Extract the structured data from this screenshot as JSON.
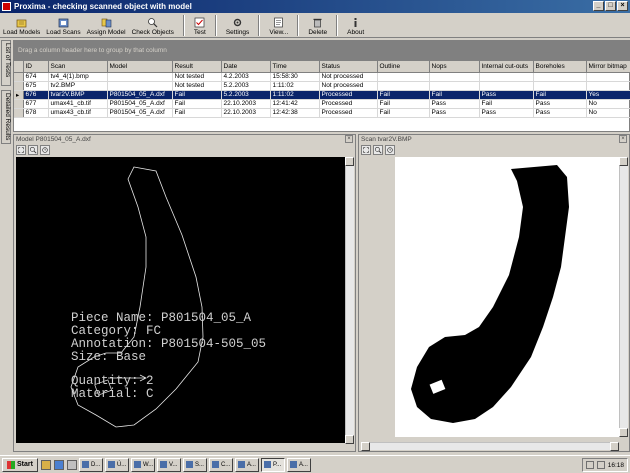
{
  "window": {
    "title": "Proxima - checking scanned object with model"
  },
  "toolbar": {
    "buttons": [
      {
        "label": "Load Models",
        "icon": "load-models-icon"
      },
      {
        "label": "Load Scans",
        "icon": "load-scans-icon"
      },
      {
        "label": "Assign Model",
        "icon": "assign-model-icon"
      },
      {
        "label": "Check Objects",
        "icon": "check-objects-icon"
      },
      {
        "label": "Test",
        "icon": "test-icon"
      },
      {
        "label": "Settings",
        "icon": "settings-icon"
      },
      {
        "label": "View...",
        "icon": "view-icon"
      },
      {
        "label": "Delete",
        "icon": "delete-icon"
      },
      {
        "label": "About",
        "icon": "about-icon"
      }
    ]
  },
  "side_tabs": {
    "list_of_tests": "List of Tests",
    "detailed_results": "Detailed Results"
  },
  "grid": {
    "group_hint": "Drag a column header here to group by that column",
    "columns": [
      "ID",
      "Scan",
      "Model",
      "Result",
      "Date",
      "Time",
      "Status",
      "Outline",
      "Nops",
      "Internal cut-outs",
      "Boreholes",
      "Mirror bitmap"
    ],
    "rows": [
      [
        "674",
        "tv4_4(1).bmp",
        "",
        "Not tested",
        "4.2.2003",
        "15:58:30",
        "Not processed",
        "",
        "",
        "",
        "",
        ""
      ],
      [
        "675",
        "tv2.BMP",
        "",
        "Not tested",
        "5.2.2003",
        "1:11:02",
        "Not processed",
        "",
        "",
        "",
        "",
        ""
      ],
      [
        "676",
        "tvar2V.BMP",
        "P801504_05_A.dxf",
        "Fail",
        "5.2.2003",
        "1:11:02",
        "Processed",
        "Fail",
        "Fail",
        "Pass",
        "Fail",
        "Yes"
      ],
      [
        "677",
        "umax41_cb.tif",
        "P801504_05_A.dxf",
        "Fail",
        "22.10.2003",
        "12:41:42",
        "Processed",
        "Fail",
        "Pass",
        "Fail",
        "Pass",
        "No"
      ],
      [
        "678",
        "umax43_cb.tif",
        "P801504_05_A.dxf",
        "Fail",
        "22.10.2003",
        "12:42:38",
        "Processed",
        "Fail",
        "Pass",
        "Pass",
        "Pass",
        "No"
      ]
    ],
    "selected_row": 2
  },
  "model_panel": {
    "title": "Model P801504_05_A.dxf",
    "piece_name": "Piece Name: P801504_05_A",
    "category": "Category: FC",
    "annotation": "Annotation: P801504-505_05",
    "size": "Size: Base",
    "quantity": "Quantity: 2",
    "material": "Material: C"
  },
  "scan_panel": {
    "title": "Scan tvar2V.BMP"
  },
  "taskbar": {
    "start": "Start",
    "tasks": [
      "D...",
      "Ú...",
      "W...",
      "V...",
      "S...",
      "C...",
      "A...",
      "P...",
      "A..."
    ],
    "active_task": 7,
    "clock": "16:18"
  }
}
